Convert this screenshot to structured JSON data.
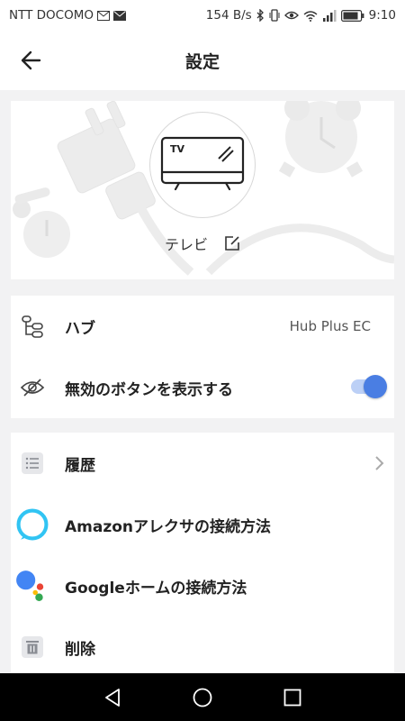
{
  "status_bar": {
    "carrier": "NTT DOCOMO",
    "net_speed": "154 B/s",
    "time": "9:10"
  },
  "app_bar": {
    "title": "設定",
    "back_icon": "arrow-left-icon"
  },
  "device": {
    "name": "テレビ",
    "icon_text": "TV",
    "edit_icon": "edit-icon"
  },
  "settings": {
    "hub": {
      "label": "ハブ",
      "value": "Hub Plus EC",
      "icon": "hub-tree-icon"
    },
    "show_disabled": {
      "label": "無効のボタンを表示する",
      "enabled": true,
      "icon": "eye-off-icon"
    }
  },
  "menu": {
    "history": {
      "label": "履歴",
      "icon": "list-icon"
    },
    "alexa": {
      "label": "Amazonアレクサの接続方法",
      "icon": "alexa-icon"
    },
    "google": {
      "label": "Googleホームの接続方法",
      "icon": "google-assistant-icon"
    },
    "delete": {
      "label": "削除",
      "icon": "trash-icon"
    }
  },
  "colors": {
    "accent": "#4a7ee3",
    "toggle_track": "#bcd0f6",
    "alexa": "#31c4f3"
  }
}
